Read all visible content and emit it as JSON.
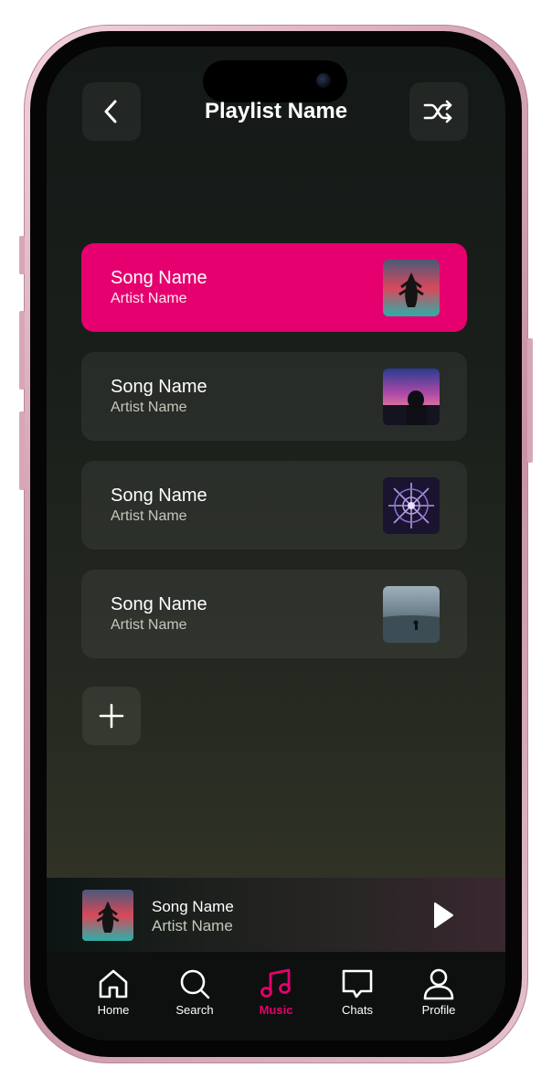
{
  "header": {
    "title": "Playlist Name",
    "back_icon": "chevron-left-icon",
    "shuffle_icon": "shuffle-icon"
  },
  "songs": [
    {
      "name": "Song Name",
      "artist": "Artist Name",
      "active": true
    },
    {
      "name": "Song Name",
      "artist": "Artist Name",
      "active": false
    },
    {
      "name": "Song Name",
      "artist": "Artist Name",
      "active": false
    },
    {
      "name": "Song Name",
      "artist": "Artist Name",
      "active": false
    }
  ],
  "add_icon": "plus-icon",
  "now_playing": {
    "song": "Song Name",
    "artist": "Artist Name",
    "play_icon": "play-icon"
  },
  "tabs": [
    {
      "label": "Home",
      "icon": "home-icon"
    },
    {
      "label": "Search",
      "icon": "search-icon"
    },
    {
      "label": "Music",
      "icon": "music-note-icon",
      "active": true
    },
    {
      "label": "Chats",
      "icon": "chat-bubble-icon"
    },
    {
      "label": "Profile",
      "icon": "user-icon"
    }
  ],
  "colors": {
    "accent": "#e6006f",
    "background_top": "#141917",
    "background_bottom": "#3a3b28",
    "card": "#2a2e29"
  }
}
